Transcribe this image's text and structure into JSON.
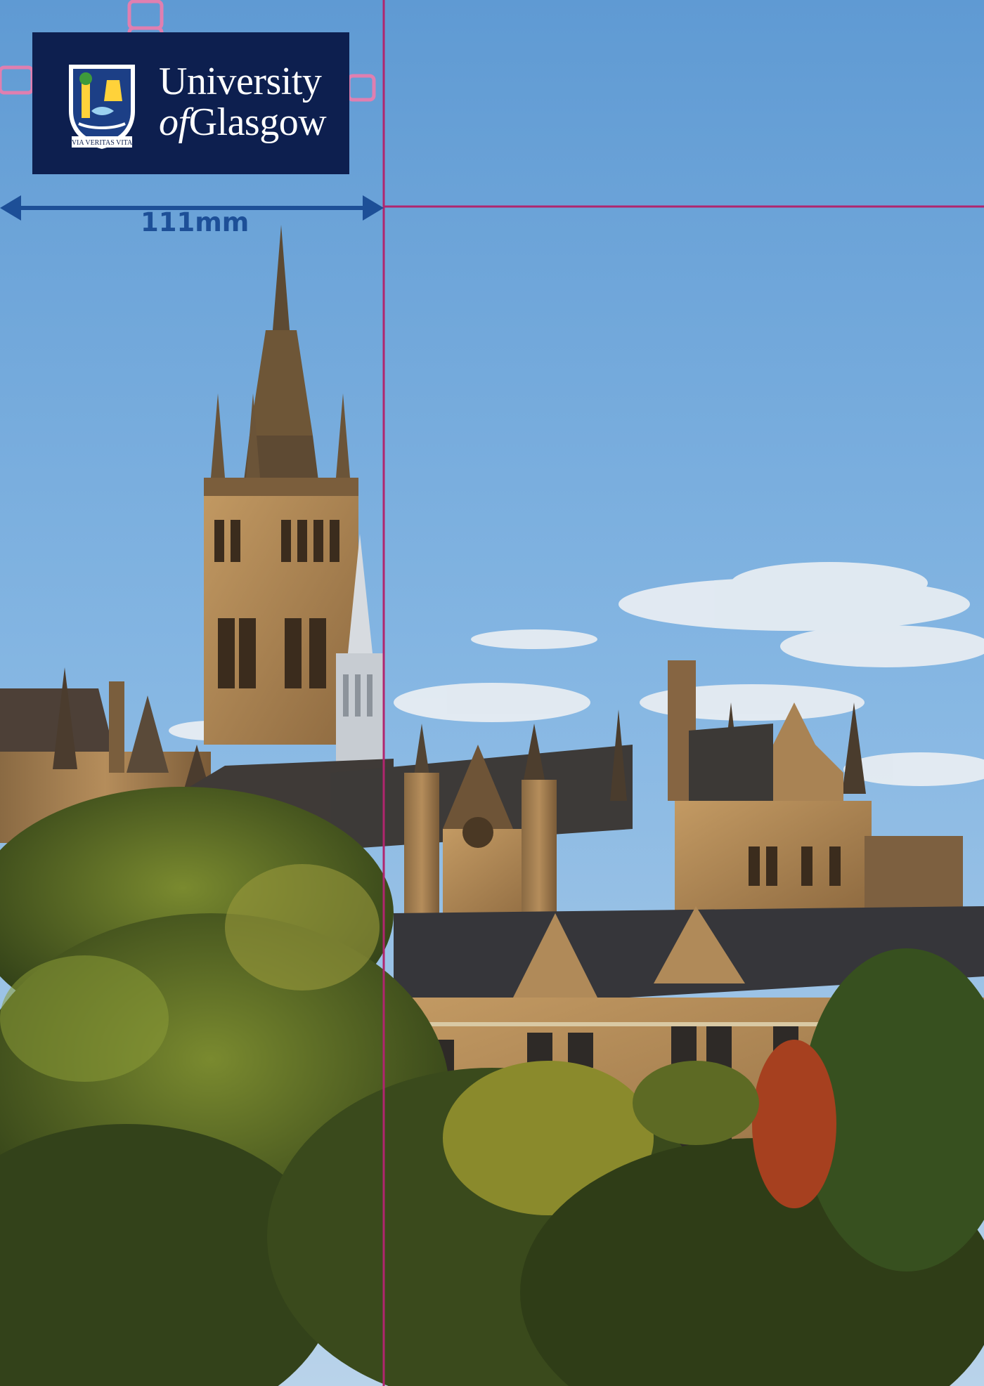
{
  "logo": {
    "line1": "University",
    "line2_prefix": "of",
    "line2_main": "Glasgow",
    "motto": "VIA VERITAS VITA",
    "colors": {
      "background": "#0d1f4f",
      "text": "#ffffff"
    }
  },
  "measurement": {
    "label": "111mm",
    "arrow_color": "#1d4f97",
    "guide_color": "#b0256e",
    "clearzone_color": "#e07fb0"
  }
}
